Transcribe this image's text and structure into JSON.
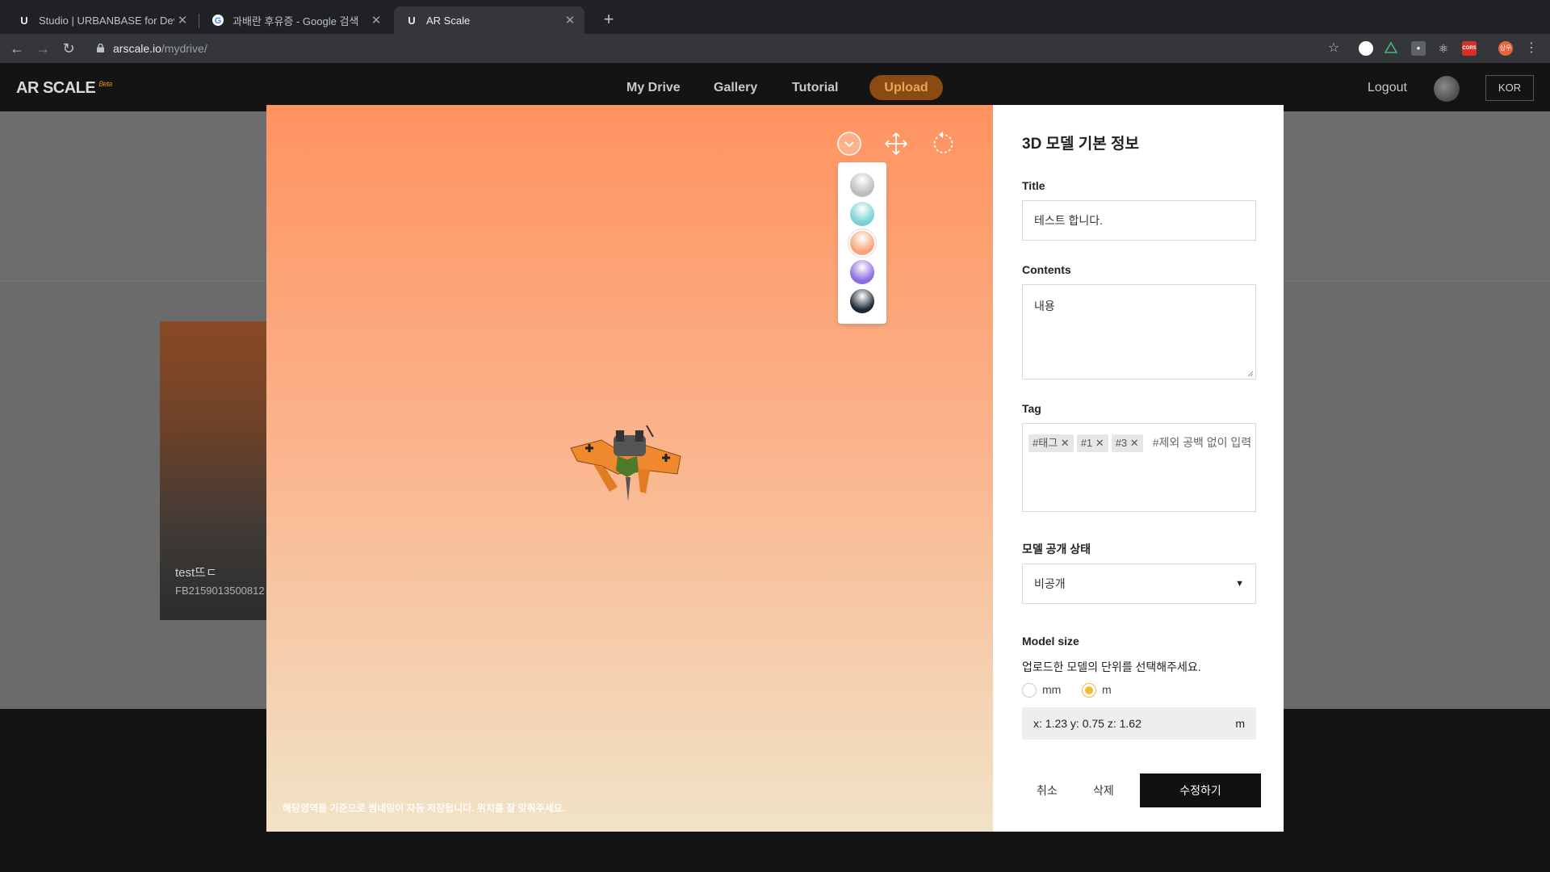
{
  "browser": {
    "tabs": [
      {
        "favicon": "U",
        "title": "Studio | URBANBASE for Devel"
      },
      {
        "favicon": "G",
        "title": "과배란 후유증 - Google 검색"
      },
      {
        "favicon": "U",
        "title": "AR Scale"
      }
    ],
    "new_tab": "+",
    "url_host": "arscale.io",
    "url_path": "/mydrive/",
    "extensions": [
      "shield-icon",
      "triangle-icon",
      "bulb-icon",
      "react-icon",
      "cors-icon",
      "profile-icon"
    ],
    "cors_label": "CORS",
    "profile_label": "상우"
  },
  "app": {
    "logo": "AR SCALE",
    "logo_badge": "Beta",
    "menu": [
      "My Drive",
      "Gallery",
      "Tutorial"
    ],
    "upload": "Upload",
    "logout": "Logout",
    "language": "KOR"
  },
  "background_card": {
    "title": "test뜨ㄷ",
    "code": "FB2159013500812"
  },
  "viewer": {
    "hint": "해당영역을 기준으로 썸네일이 자동 저장됩니다. 위치를 잘 맞춰주세요.",
    "palette": [
      "#bdbdbd",
      "#79d0d6",
      "#f9a378",
      "#8b6cdc",
      "#1d2836"
    ],
    "selected_swatch": 2
  },
  "panel": {
    "heading": "3D 모델 기본 정보",
    "title_label": "Title",
    "title_value": "테스트 합니다.",
    "contents_label": "Contents",
    "contents_value": "내용",
    "tag_label": "Tag",
    "tags": [
      "#태그",
      "#1",
      "#3"
    ],
    "tag_placeholder": "#제외 공백 없이 입력",
    "status_label": "모델 공개 상태",
    "status_value": "비공개",
    "size_label": "Model size",
    "size_desc": "업로드한 모델의 단위를 선택해주세요.",
    "unit_options": [
      "mm",
      "m"
    ],
    "unit_selected": "m",
    "dims": "x: 1.23  y: 0.75  z: 1.62",
    "dims_unit": "m",
    "cancel": "취소",
    "delete": "삭제",
    "save": "수정하기"
  }
}
